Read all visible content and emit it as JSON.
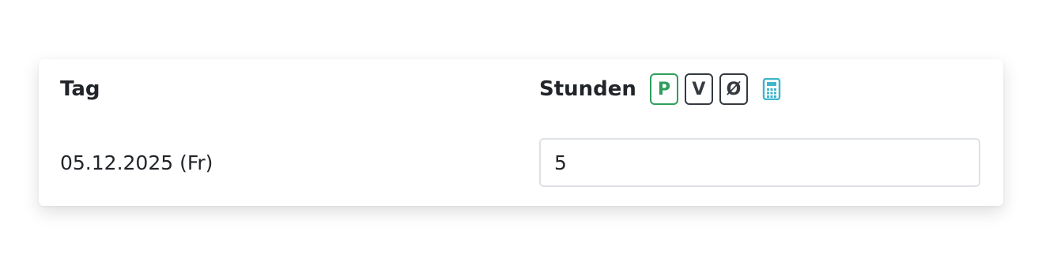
{
  "table": {
    "headers": {
      "day": "Tag",
      "hours": "Stunden"
    },
    "badges": [
      {
        "label": "P",
        "active": true
      },
      {
        "label": "V",
        "active": false
      },
      {
        "label": "Ø",
        "active": false
      }
    ],
    "calculator_icon": "calculator-icon",
    "rows": [
      {
        "day": "05.12.2025 (Fr)",
        "hours": "5"
      }
    ]
  },
  "colors": {
    "active_badge": "#2e9e5b",
    "badge_default": "#343a40",
    "calculator_icon": "#3fb6cc",
    "input_border": "#dee2e6"
  }
}
